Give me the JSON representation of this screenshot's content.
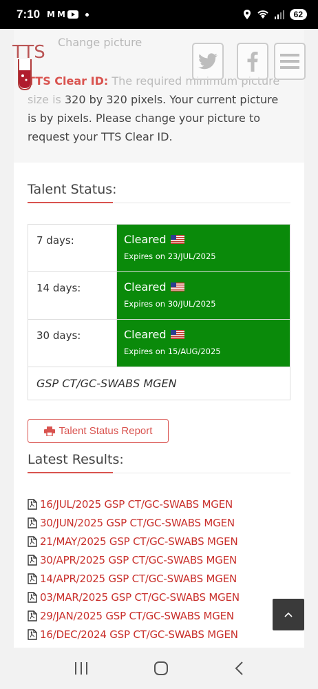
{
  "status_bar": {
    "time": "7:10",
    "battery": "62"
  },
  "notice": {
    "faded_top": "Change picture",
    "label": "TTS Clear ID:",
    "text_faded": " The required minimum picture size is",
    "text": "320 by 320 pixels. Your current picture is by pixels. Please change your picture to request your TTS Clear ID."
  },
  "header": {
    "logo": "TTS"
  },
  "talent_status": {
    "heading": "Talent Status:",
    "rows": [
      {
        "period": "7 days:",
        "status": "Cleared",
        "expires": "Expires on 23/JUL/2025"
      },
      {
        "period": "14 days:",
        "status": "Cleared",
        "expires": "Expires on 30/JUL/2025"
      },
      {
        "period": "30 days:",
        "status": "Cleared",
        "expires": "Expires on 15/AUG/2025"
      }
    ],
    "test_name": "GSP CT/GC-SWABS MGEN",
    "report_button": "Talent Status Report"
  },
  "latest_results": {
    "heading": "Latest Results:",
    "items": [
      "16/JUL/2025 GSP CT/GC-SWABS MGEN",
      "30/JUN/2025 GSP CT/GC-SWABS MGEN",
      "21/MAY/2025 GSP CT/GC-SWABS MGEN",
      "30/APR/2025 GSP CT/GC-SWABS MGEN",
      "14/APR/2025 GSP CT/GC-SWABS MGEN",
      "03/MAR/2025 GSP CT/GC-SWABS MGEN",
      "29/JAN/2025 GSP CT/GC-SWABS MGEN",
      "16/DEC/2024 GSP CT/GC-SWABS MGEN"
    ]
  },
  "colors": {
    "accent": "#d9534f",
    "cleared": "#0a8a0a"
  },
  "icons": [
    "twitter-icon",
    "facebook-icon",
    "menu-icon",
    "printer-icon",
    "pdf-icon",
    "chevron-up-icon",
    "us-flag-icon"
  ]
}
